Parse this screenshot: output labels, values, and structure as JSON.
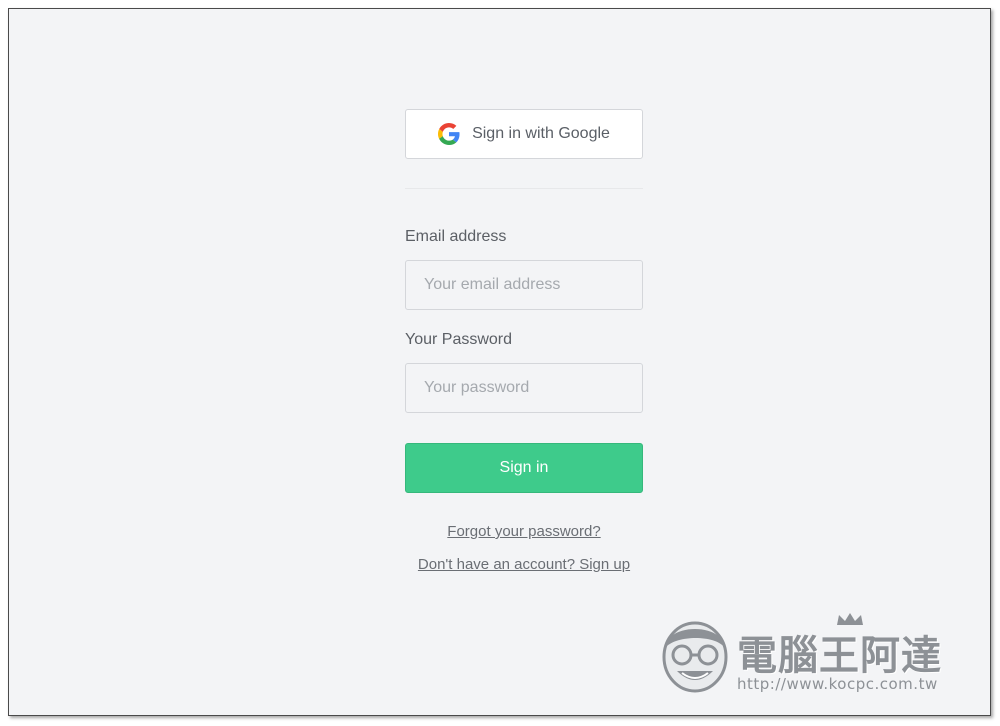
{
  "google_button": {
    "label": "Sign in with Google",
    "icon": "google-g-icon"
  },
  "email": {
    "label": "Email address",
    "placeholder": "Your email address",
    "value": ""
  },
  "password": {
    "label": "Your Password",
    "placeholder": "Your password",
    "value": ""
  },
  "signin_button": {
    "label": "Sign in"
  },
  "links": {
    "forgot": "Forgot your password?",
    "signup": "Don't have an account? Sign up"
  },
  "watermark": {
    "title": "電腦王阿達",
    "url": "http://www.kocpc.com.tw"
  },
  "colors": {
    "background": "#f3f4f6",
    "accent": "#3ecb8b",
    "border": "#d4d6da"
  }
}
